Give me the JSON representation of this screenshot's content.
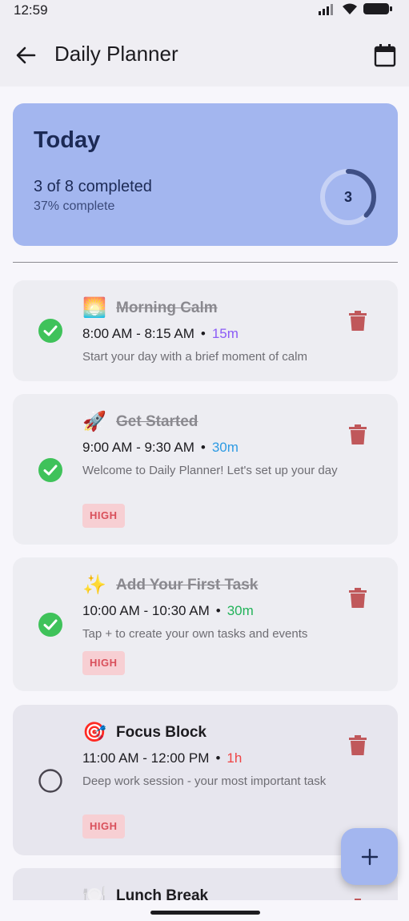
{
  "status": {
    "time": "12:59"
  },
  "header": {
    "title": "Daily Planner"
  },
  "today": {
    "title": "Today",
    "completed_text": "3 of 8 completed",
    "percent_text": "37% complete",
    "ring_value": "3",
    "progress_fraction": 0.375
  },
  "tasks": [
    {
      "emoji": "🌅",
      "title": "Morning Calm",
      "time": "8:00 AM - 8:15 AM",
      "dot": "•",
      "duration": "15m",
      "duration_color": "#8b5cf6",
      "description": "Start your day with a brief moment of calm",
      "priority": "",
      "completed": true
    },
    {
      "emoji": "🚀",
      "title": "Get Started",
      "time": "9:00 AM - 9:30 AM",
      "dot": "•",
      "duration": "30m",
      "duration_color": "#2e9be3",
      "description": "Welcome to Daily Planner! Let's set up your day",
      "priority": "HIGH",
      "completed": true
    },
    {
      "emoji": "✨",
      "title": "Add Your First Task",
      "time": "10:00 AM - 10:30 AM",
      "dot": "•",
      "duration": "30m",
      "duration_color": "#22b35a",
      "description": "Tap + to create your own tasks and events",
      "priority": "HIGH",
      "completed": true
    },
    {
      "emoji": "🎯",
      "title": "Focus Block",
      "time": "11:00 AM - 12:00 PM",
      "dot": "•",
      "duration": "1h",
      "duration_color": "#ef4444",
      "description": "Deep work session - your most important task",
      "priority": "HIGH",
      "completed": false
    },
    {
      "emoji": "🍽️",
      "title": "Lunch Break",
      "time": "",
      "dot": "",
      "duration": "",
      "duration_color": "#1c1b1f",
      "description": "",
      "priority": "",
      "completed": false
    }
  ],
  "colors": {
    "accent": "#a3b6ef",
    "check_green": "#3fc25a",
    "trash_red": "#c0585b",
    "badge_bg": "#f7cfd3",
    "badge_text": "#d9505b"
  }
}
